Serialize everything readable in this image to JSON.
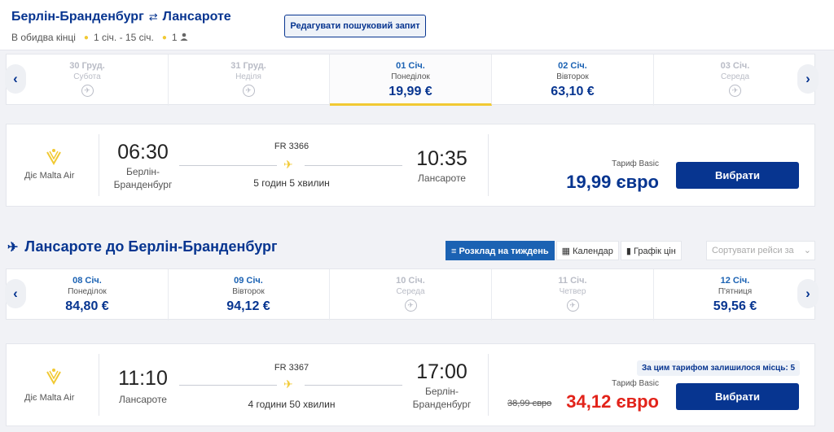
{
  "header": {
    "from": "Берлін-Бранденбург",
    "swap_icon": "⇄",
    "to": "Лансароте",
    "trip_type": "В обидва кінці",
    "dates": "1 січ. - 15 січ.",
    "passengers": "1",
    "edit_button": "Редагувати пошуковий запит"
  },
  "outbound_dates": [
    {
      "date": "30  Груд.",
      "weekday": "Субота",
      "price": "",
      "available": false
    },
    {
      "date": "31  Груд.",
      "weekday": "Неділя",
      "price": "",
      "available": false
    },
    {
      "date": "01  Січ.",
      "weekday": "Понеділок",
      "price": "19,99 €",
      "available": true,
      "selected": true
    },
    {
      "date": "02  Січ.",
      "weekday": "Вівторок",
      "price": "63,10 €",
      "available": true
    },
    {
      "date": "03  Січ.",
      "weekday": "Середа",
      "price": "",
      "available": false
    }
  ],
  "outbound_flight": {
    "operator": "Діє Malta Air",
    "dep_time": "06:30",
    "dep_city": "Берлін-Бранденбург",
    "flight_no": "FR 3366",
    "duration": "5 годин 5 хвилин",
    "arr_time": "10:35",
    "arr_city": "Лансароте",
    "fare": "Тариф Basic",
    "price": "19,99 євро",
    "choose": "Вибрати"
  },
  "return": {
    "title": "Лансароте до Берлін-Бранденбург",
    "tabs": [
      {
        "label": "Розклад на тиждень",
        "icon": "list-icon"
      },
      {
        "label": "Календар",
        "icon": "calendar-icon"
      },
      {
        "label": "Графік цін",
        "icon": "chart-icon"
      }
    ],
    "sort_placeholder": "Сортувати рейси за"
  },
  "return_dates": [
    {
      "date": "08  Січ.",
      "weekday": "Понеділок",
      "price": "84,80 €",
      "available": true
    },
    {
      "date": "09  Січ.",
      "weekday": "Вівторок",
      "price": "94,12 €",
      "available": true
    },
    {
      "date": "10  Січ.",
      "weekday": "Середа",
      "price": "",
      "available": false
    },
    {
      "date": "11  Січ.",
      "weekday": "Четвер",
      "price": "",
      "available": false
    },
    {
      "date": "12  Січ.",
      "weekday": "П'ятниця",
      "price": "59,56 €",
      "available": true
    }
  ],
  "return_flight": {
    "operator": "Діє Malta Air",
    "dep_time": "11:10",
    "dep_city": "Лансароте",
    "flight_no": "FR 3367",
    "duration": "4 години 50 хвилин",
    "arr_time": "17:00",
    "arr_city": "Берлін-Бранденбург",
    "seats_left": "За цим тарифом залишилося місць: 5",
    "fare": "Тариф Basic",
    "old_price": "38,99 євро",
    "price": "34,12 євро",
    "choose": "Вибрати"
  },
  "colors": {
    "brand": "#073590",
    "accent": "#f1c933",
    "link": "#1b62b3",
    "sale": "#e2231a"
  }
}
